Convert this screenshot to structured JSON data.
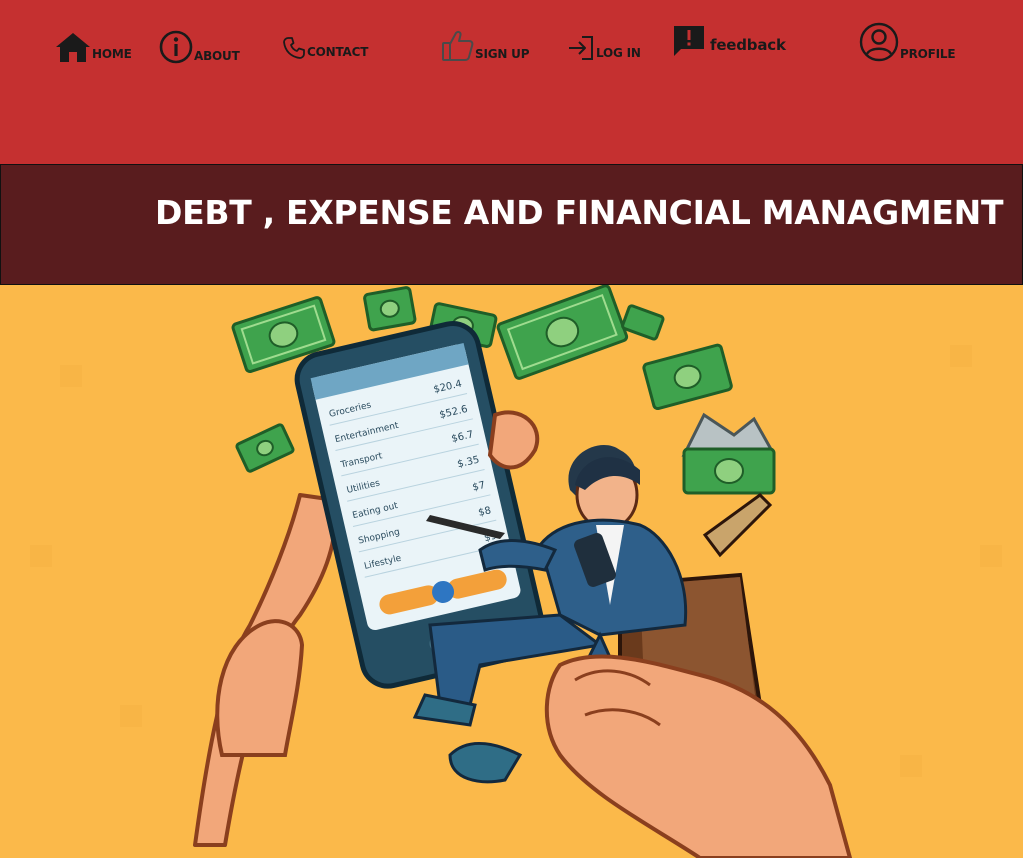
{
  "nav": {
    "items": [
      {
        "label": "HOME",
        "icon": "home-icon"
      },
      {
        "label": "ABOUT",
        "icon": "info-icon"
      },
      {
        "label": "CONTACT",
        "icon": "phone-icon"
      },
      {
        "label": "SIGN UP",
        "icon": "thumbs-up-icon"
      },
      {
        "label": "LOG IN",
        "icon": "login-icon"
      },
      {
        "label": "feedback",
        "icon": "feedback-icon"
      },
      {
        "label": "PROFILE",
        "icon": "user-icon"
      }
    ]
  },
  "banner": {
    "title": "DEBT , EXPENSE AND FINANCIAL MANAGMENT"
  },
  "hero": {
    "phone_rows": [
      {
        "label": "Groceries",
        "amount": "$20.4"
      },
      {
        "label": "Entertainment",
        "amount": "$52.6"
      },
      {
        "label": "Transport",
        "amount": "$6.7"
      },
      {
        "label": "Utilities",
        "amount": "$.35"
      },
      {
        "label": "Eating out",
        "amount": "$7"
      },
      {
        "label": "Shopping",
        "amount": "$8"
      },
      {
        "label": "Lifestyle",
        "amount": "$9"
      }
    ]
  },
  "colors": {
    "nav_bg": "#c53030",
    "banner_bg": "#591c1e",
    "hero_bg": "#fbb94a"
  }
}
